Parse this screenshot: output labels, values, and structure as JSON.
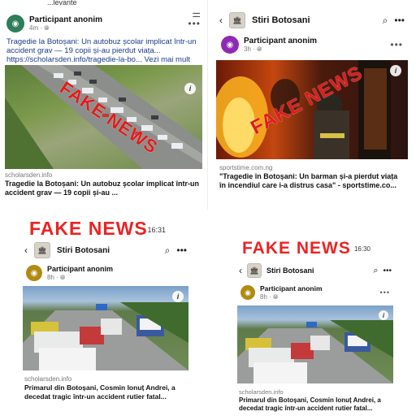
{
  "panel1": {
    "top_text": "...levante",
    "poster_name": "Participant anonim",
    "poster_time": "4m",
    "caption": "Tragedie la Botoșani: Un autobuz școlar implicat într-un accident grav — 19 copii și-au pierdut viața... https://scholarsden.info/tragedie-la-bo... Vezi mai mult",
    "stamp": "FAKE NEWS",
    "source": "scholarsden.info",
    "title": "Tragedie la Botoșani: Un autobuz școlar implicat într-un accident grav — 19 copii și-au ..."
  },
  "panel2": {
    "page_name": "Stiri Botosani",
    "poster_name": "Participant anonim",
    "poster_time": "3h",
    "stamp": "FAKE NEWS",
    "source": "sportstime.com.ng",
    "title": "\"Tragedie în Botoșani: Un barman și-a pierdut viața în incendiul care i-a distrus casa\" - sportstime.co..."
  },
  "panel3": {
    "overlay": "FAKE NEWS",
    "time": "16:31",
    "page_name": "Stiri Botosani",
    "poster_name": "Participant anonim",
    "poster_time": "8h",
    "source": "scholarsden.info",
    "title": "Primarul din Botoșani, Cosmin Ionuț Andrei, a decedat tragic într-un accident rutier fatal..."
  },
  "panel4": {
    "overlay": "FAKE NEWS",
    "time": "16:30",
    "page_name": "Stiri Botosani",
    "poster_name": "Participant anonim",
    "poster_time": "8h",
    "source": "scholarsden.info",
    "title": "Primarul din Botoșani, Cosmin Ionuț Andrei, a decedat tragic într-un accident rutier fatal..."
  },
  "icons": {
    "back": "chevron-left-icon",
    "search": "search-icon",
    "more": "more-dots-icon",
    "filter": "filter-icon",
    "info": "info-icon",
    "globe": "globe-icon"
  },
  "colors": {
    "stamp_red": "#e01b1b",
    "avatar_green": "#2e7d5b",
    "avatar_purple": "#8e2ab4",
    "avatar_olive": "#b08a12"
  }
}
